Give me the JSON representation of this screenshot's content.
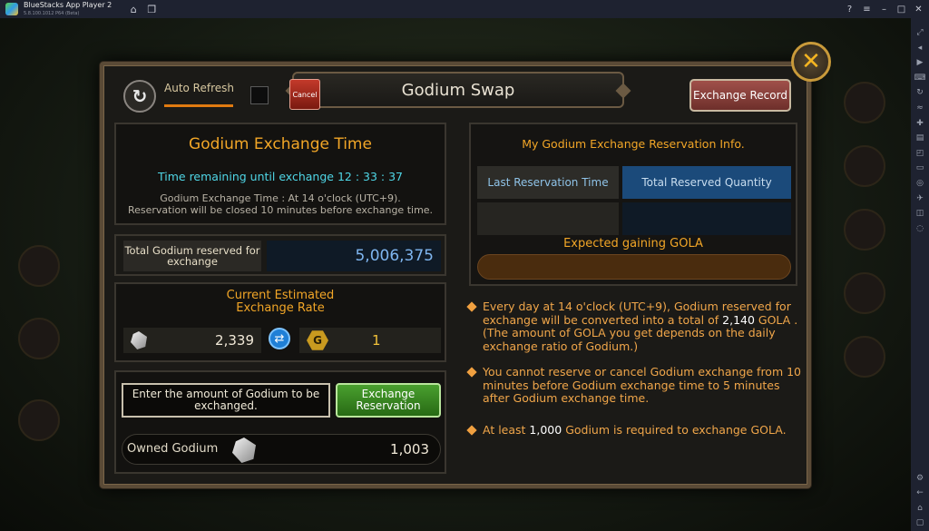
{
  "window": {
    "title": "BlueStacks App Player 2",
    "version": "5.8.100.1012 P64 (Beta)"
  },
  "modal": {
    "title": "Godium Swap",
    "auto_refresh_label": "Auto Refresh",
    "exchange_record_label": "Exchange Record",
    "close_symbol": "✕"
  },
  "exchange_time": {
    "heading": "Godium Exchange Time",
    "remaining_text": "Time remaining until exchange 12 : 33 : 37",
    "note_line1": "Godium Exchange Time : At 14 o'clock (UTC+9).",
    "note_line2": "Reservation will be closed 10 minutes before exchange time."
  },
  "total_reserved": {
    "label": "Total Godium reserved for exchange",
    "value": "5,006,375"
  },
  "rate": {
    "heading_line1": "Current Estimated",
    "heading_line2": "Exchange Rate",
    "godium_value": "2,339",
    "gola_value": "1"
  },
  "exchange_input": {
    "placeholder": "Enter the amount of Godium to be exchanged.",
    "reserve_button": "Exchange Reservation",
    "owned_label": "Owned Godium",
    "owned_value": "1,003"
  },
  "reservation_info": {
    "heading": "My Godium Exchange Reservation Info.",
    "col_last_time": "Last Reservation Time",
    "col_total_qty": "Total Reserved Quantity",
    "cancel_button": "Cancel",
    "expected_label": "Expected gaining GOLA"
  },
  "notes": {
    "n1_a": "Every day at 14 o'clock (UTC+9), Godium reserved for exchange will be converted into a total of ",
    "n1_num": "2,140",
    "n1_b": " GOLA .(The amount of GOLA you get depends on the daily exchange ratio of Godium.)",
    "n2": "You cannot reserve or cancel Godium exchange from 10 minutes before Godium exchange time to 5 minutes after Godium exchange time.",
    "n3_a": "At least ",
    "n3_num": "1,000",
    "n3_b": " Godium is required to exchange GOLA."
  },
  "colors": {
    "accent_orange": "#f2a627",
    "cyan_timer": "#4fd6e6",
    "value_blue": "#7fb6f0",
    "reserve_green": "#4aa02f",
    "record_red": "#a0504a"
  }
}
